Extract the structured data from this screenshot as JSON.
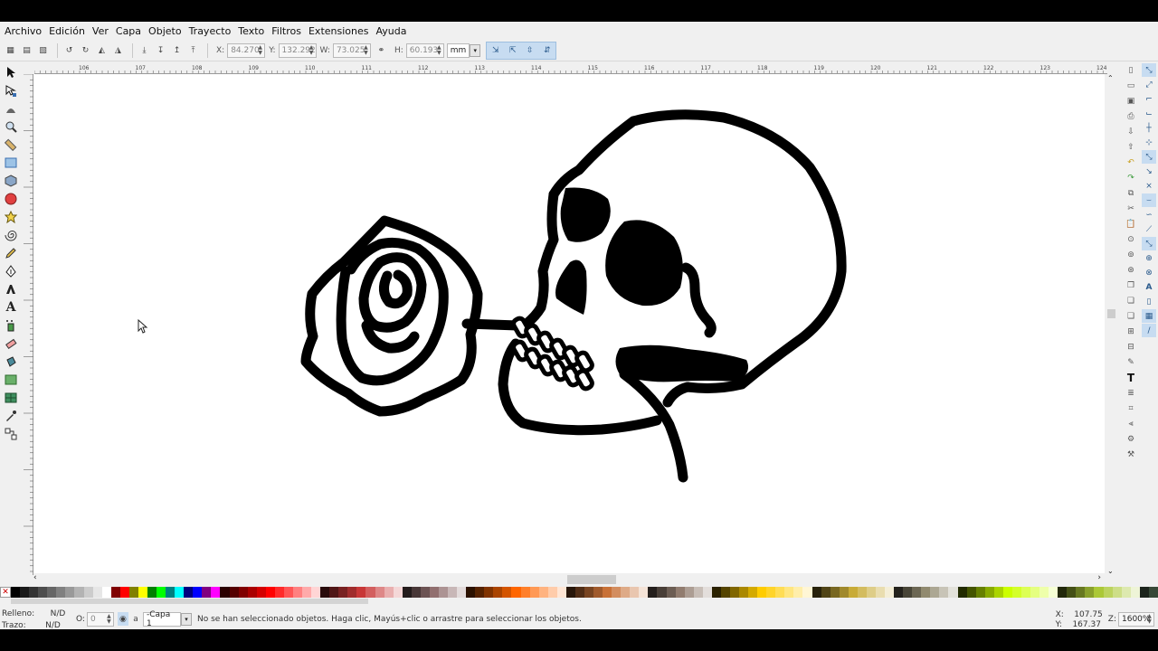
{
  "menu": [
    "Archivo",
    "Edición",
    "Ver",
    "Capa",
    "Objeto",
    "Trayecto",
    "Texto",
    "Filtros",
    "Extensiones",
    "Ayuda"
  ],
  "toolbar": {
    "x_label": "X:",
    "x_value": "84.270",
    "y_label": "Y:",
    "y_value": "132.292",
    "w_label": "W:",
    "w_value": "73.025",
    "h_label": "H:",
    "h_value": "60.193",
    "unit": "mm"
  },
  "ruler_labels": [
    "106",
    "107",
    "108",
    "109",
    "110",
    "111",
    "112",
    "113",
    "114",
    "115",
    "116",
    "117",
    "118",
    "119",
    "120",
    "121",
    "122",
    "123",
    "124"
  ],
  "tools": [
    "selector-icon",
    "node-icon",
    "tweak-icon",
    "zoom-icon",
    "measure-icon",
    "rect-icon",
    "box3d-icon",
    "ellipse-icon",
    "star-icon",
    "spiral-icon",
    "pencil-icon",
    "pen-icon",
    "calligraphy-icon",
    "text-icon",
    "spray-icon",
    "eraser-icon",
    "bucket-icon",
    "gradient-icon",
    "mesh-icon",
    "dropper-icon",
    "connector-icon"
  ],
  "palette": [
    "#000000",
    "#1a1a1a",
    "#333333",
    "#4d4d4d",
    "#666666",
    "#808080",
    "#999999",
    "#b3b3b3",
    "#cccccc",
    "#e6e6e6",
    "#ffffff",
    "#800000",
    "#ff0000",
    "#808000",
    "#ffff00",
    "#008000",
    "#00ff00",
    "#008080",
    "#00ffff",
    "#000080",
    "#0000ff",
    "#800080",
    "#ff00ff",
    "#2b0000",
    "#550000",
    "#800000",
    "#aa0000",
    "#d40000",
    "#ff0000",
    "#ff2a2a",
    "#ff5555",
    "#ff8080",
    "#ffaaaa",
    "#ffd5d5",
    "#280b0b",
    "#501616",
    "#782121",
    "#a02c2c",
    "#c83737",
    "#d35f5f",
    "#de8787",
    "#e9afaf",
    "#f4d7d7",
    "#241c1c",
    "#483737",
    "#6c5353",
    "#916f6f",
    "#ac9393",
    "#c8b7b7",
    "#e3dbdb",
    "#2b1100",
    "#552200",
    "#803300",
    "#aa4400",
    "#d45500",
    "#ff6600",
    "#ff7f2a",
    "#ff9955",
    "#ffb380",
    "#ffccaa",
    "#ffe6d5",
    "#28170b",
    "#502d16",
    "#784421",
    "#a05a2c",
    "#c87137",
    "#d38d5f",
    "#deaa87",
    "#e9c6af",
    "#f4e3d7",
    "#241f1c",
    "#483e37",
    "#6c5d53",
    "#917c6f",
    "#ac9d93",
    "#c8beb7",
    "#e3dedb",
    "#2b2200",
    "#554400",
    "#806600",
    "#aa8800",
    "#d4aa00",
    "#ffcc00",
    "#ffd42a",
    "#ffdd55",
    "#ffe680",
    "#ffeeaa",
    "#fff6d5",
    "#28220b",
    "#504416",
    "#786721",
    "#a0892c",
    "#c8ab37",
    "#d3bc5f",
    "#decd87",
    "#e9ddaf",
    "#f4eed7",
    "#24221c",
    "#484537",
    "#6c6753",
    "#918a6f",
    "#aca793",
    "#c8c4b7",
    "#e3e2db",
    "#222b00",
    "#445500",
    "#668000",
    "#88aa00",
    "#aad400",
    "#ccff00",
    "#d4ff2a",
    "#ddff55",
    "#e5ff80",
    "#eeffaa",
    "#f6ffd5",
    "#22280b",
    "#445016",
    "#677821",
    "#89a02c",
    "#abc837",
    "#bcd35f",
    "#cdde87",
    "#dde9af",
    "#eef4d7",
    "#1c241c",
    "#374837"
  ],
  "status": {
    "fill_label": "Relleno:",
    "fill_value": "N/D",
    "stroke_label": "Trazo:",
    "stroke_value": "N/D",
    "opacity_label": "O:",
    "opacity_value": "0",
    "layer": "-Capa 1",
    "message": "No se han seleccionado objetos. Haga clic, Mayús+clic o arrastre para seleccionar los objetos.",
    "cursor_x_label": "X:",
    "cursor_x": "107.75",
    "cursor_y_label": "Y:",
    "cursor_y": "167.37",
    "zoom_label": "Z:",
    "zoom": "1600%"
  }
}
